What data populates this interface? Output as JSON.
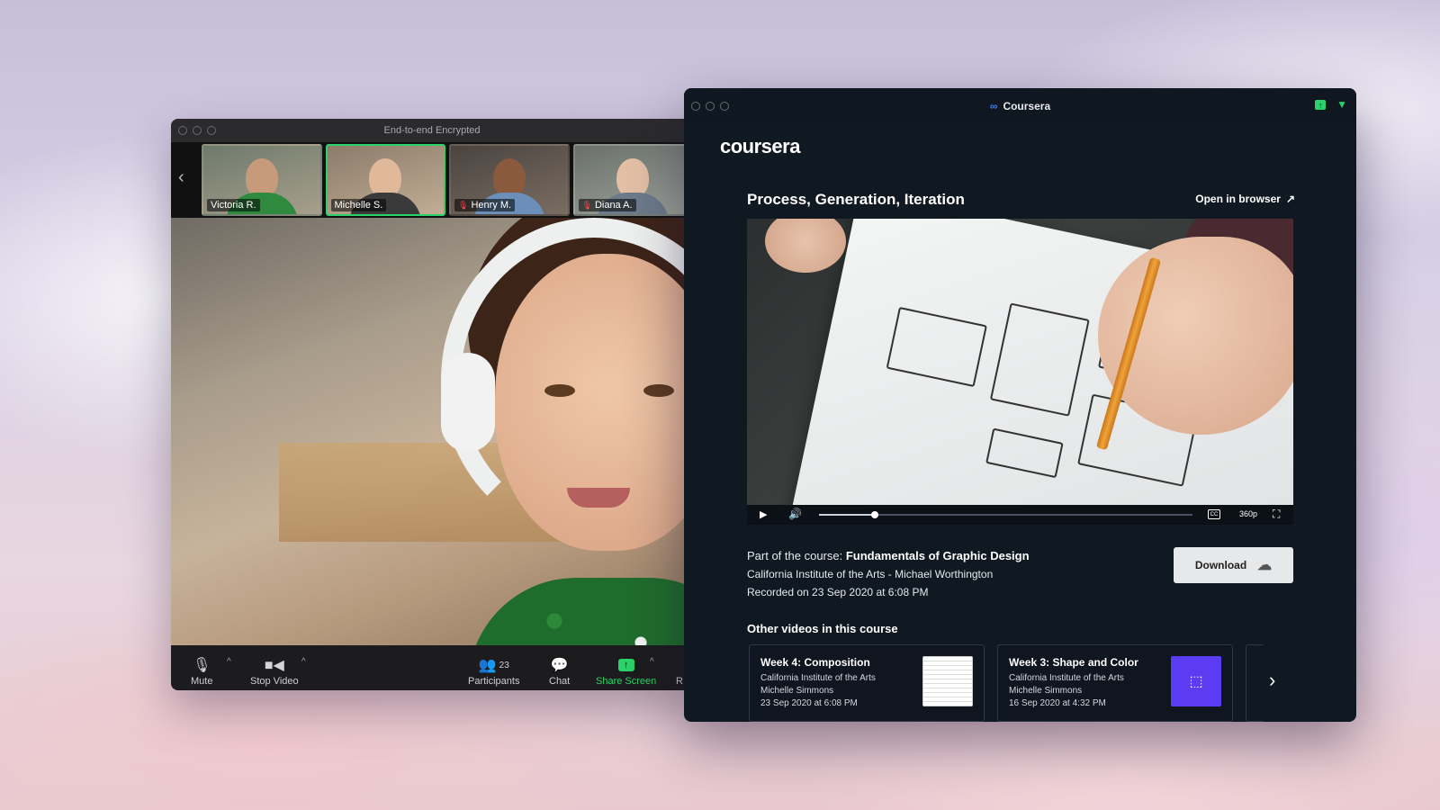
{
  "zoom": {
    "title": "End-to-end Encrypted",
    "participants": [
      {
        "name": "Victoria R.",
        "muted": false
      },
      {
        "name": "Michelle S.",
        "muted": false
      },
      {
        "name": "Henry M.",
        "muted": true
      },
      {
        "name": "Diana A.",
        "muted": true
      }
    ],
    "toolbar": {
      "mute": "Mute",
      "stop_video": "Stop Video",
      "participants": "Participants",
      "participant_count": "23",
      "chat": "Chat",
      "share_screen": "Share Screen",
      "more": "R"
    },
    "colors": {
      "active_speaker": "#2bd16b",
      "share": "#2bd16b"
    }
  },
  "coursera": {
    "window_title": "Coursera",
    "logo": "coursera",
    "lesson_title": "Process, Generation, Iteration",
    "open_in_browser": "Open in browser",
    "video": {
      "quality": "360p",
      "progress": 0.15
    },
    "course_prefix": "Part of the course:",
    "course_name": "Fundamentals of Graphic Design",
    "institution_line": "California Institute of the Arts - Michael Worthington",
    "recorded": "Recorded on 23 Sep 2020 at 6:08 PM",
    "download": "Download",
    "other_heading": "Other videos in this course",
    "cards": [
      {
        "title": "Week 4: Composition",
        "school": "California Institute of the Arts",
        "instructor": "Michelle Simmons",
        "date": "23 Sep 2020 at 6:08 PM"
      },
      {
        "title": "Week 3: Shape and Color",
        "school": "California Institute of the Arts",
        "instructor": "Michelle Simmons",
        "date": "16 Sep 2020 at 4:32 PM"
      }
    ]
  }
}
